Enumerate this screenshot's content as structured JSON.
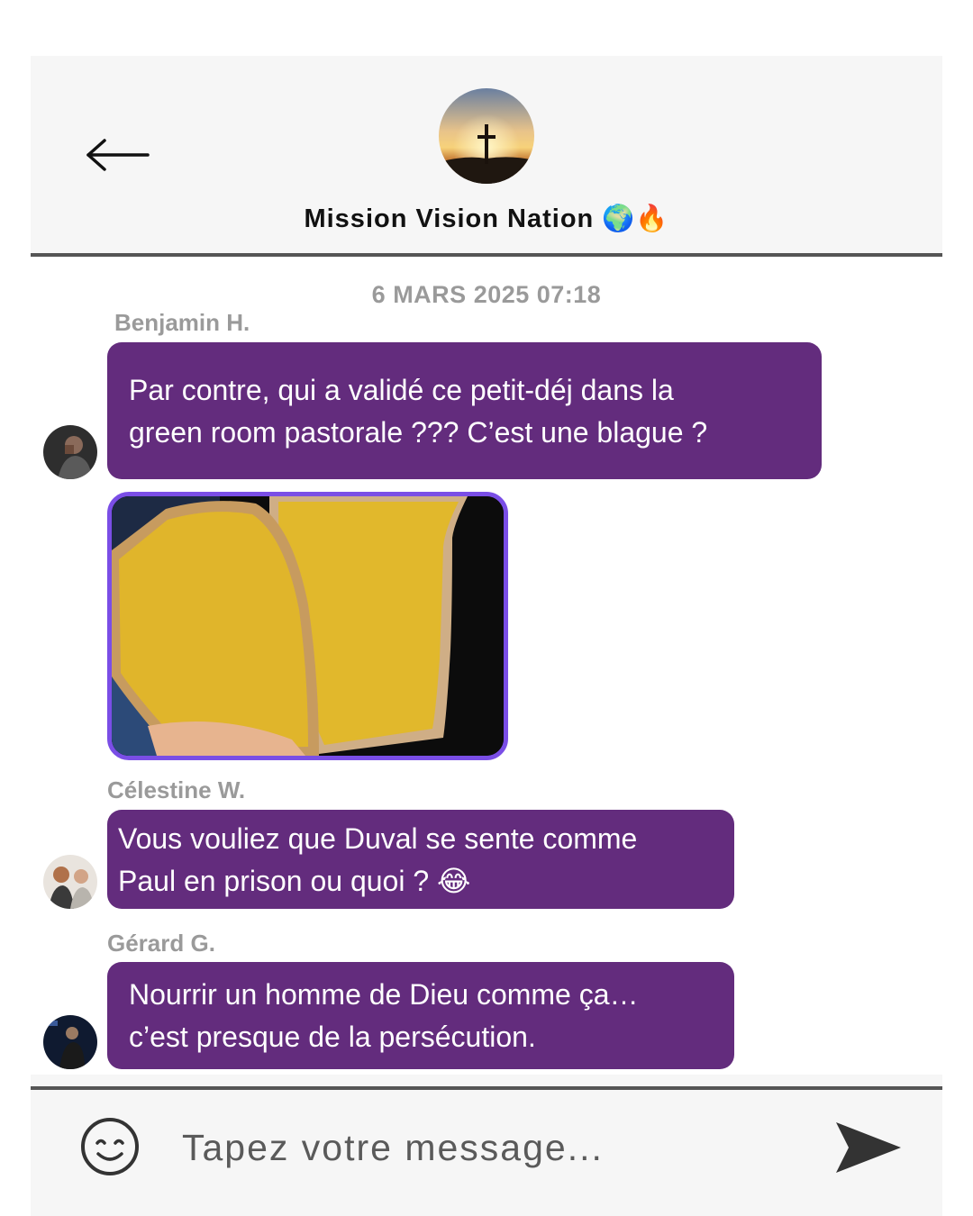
{
  "header": {
    "back_icon": "arrow-left-icon",
    "group_name": "Mission Vision Nation",
    "group_emojis": "🌍🔥"
  },
  "thread": {
    "timestamp": "6 MARS 2025 07:18",
    "messages": [
      {
        "sender": "Benjamin H.",
        "lines": [
          "Par contre, qui a validé ce petit-déj dans la",
          "green room pastorale ??? C’est une blague ?"
        ]
      },
      {
        "sender": "Célestine W.",
        "lines": [
          "Vous vouliez que Duval se sente comme",
          "Paul en prison ou quoi ?"
        ],
        "emoji": "😂"
      },
      {
        "sender": "Gérard G.",
        "lines": [
          "Nourrir un homme de Dieu comme ça…",
          "c’est presque de la persécution."
        ]
      }
    ]
  },
  "composer": {
    "placeholder": "Tapez votre message...",
    "emoji_icon": "smiley-icon",
    "send_icon": "send-arrow-icon"
  },
  "colors": {
    "bubble": "#632c7d",
    "image_border": "#7a4ee6",
    "meta_text": "#9a9a9a"
  }
}
